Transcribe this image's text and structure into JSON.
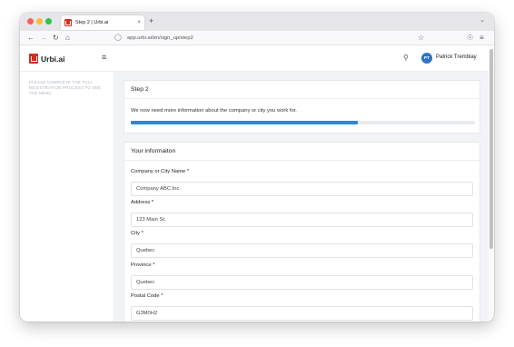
{
  "browser": {
    "tab_title": "Step 2 | Urbi.ai",
    "tab_close": "×",
    "new_tab": "+",
    "url": "app.urbi.ai/en/sign_up/step2"
  },
  "header": {
    "logo_text": "Urbi.ai",
    "avatar_initials": "PT",
    "user_name": "Patrick Tremblay"
  },
  "sidebar": {
    "message": "PLEASE COMPLETE THE FULL REGISTRATION PROCESS TO SEE THE MENU"
  },
  "step_card": {
    "title": "Step 2",
    "description": "We now need more information about the company or city you work for.",
    "progress_fraction": 0.66
  },
  "info_card": {
    "title": "Your informaiton",
    "fields": [
      {
        "label": "Company or City Name",
        "required": "*",
        "value": "Company ABC Inc."
      },
      {
        "label": "Address",
        "required": "*",
        "value": "123 Main St."
      },
      {
        "label": "City",
        "required": "*",
        "value": "Quebec"
      },
      {
        "label": "Province",
        "required": "*",
        "value": "Quebec"
      },
      {
        "label": "Postal Code",
        "required": "*",
        "value": "G3M0H2"
      }
    ]
  },
  "icons": {
    "back": "back-arrow-icon",
    "forward": "forward-arrow-icon",
    "reload": "reload-icon",
    "home": "home-icon",
    "shield": "shield-icon",
    "bookmark": "star-icon",
    "pocket": "pocket-icon",
    "menu": "hamburger-icon",
    "search": "search-icon"
  },
  "colors": {
    "brand": "#d62b1f",
    "accent": "#2f86d6",
    "avatar": "#2f74c0"
  }
}
